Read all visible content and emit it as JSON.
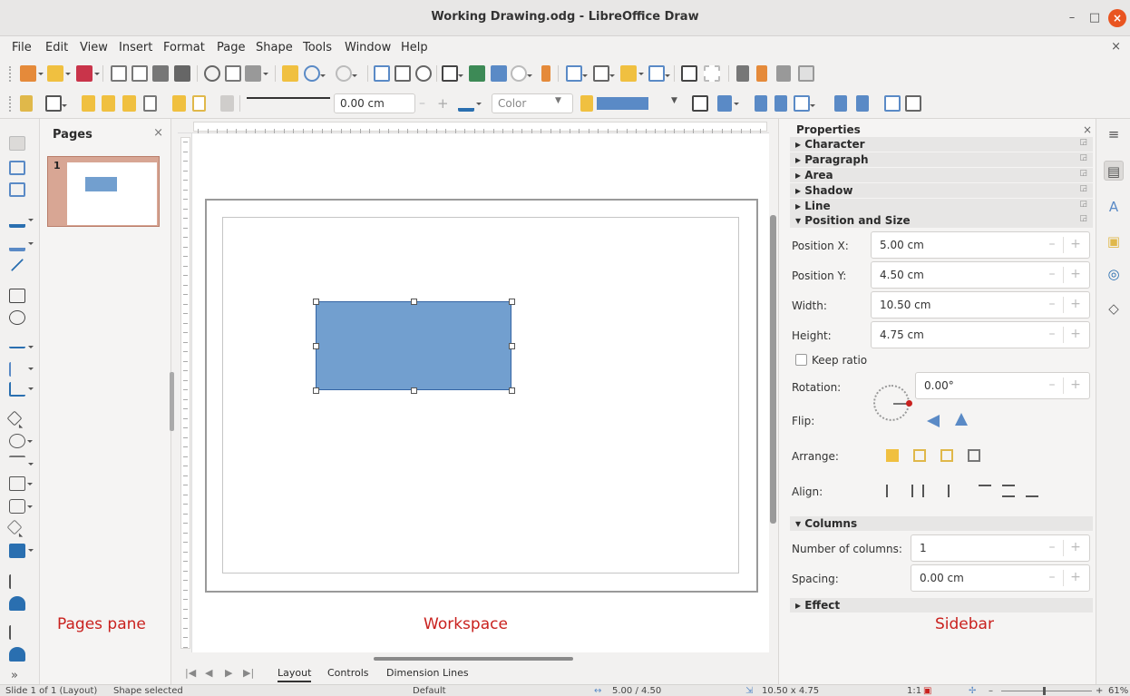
{
  "window": {
    "title": "Working Drawing.odg - LibreOffice Draw",
    "minimize": "–",
    "maximize": "□",
    "close": "×"
  },
  "menubar": {
    "items": [
      "File",
      "Edit",
      "View",
      "Insert",
      "Format",
      "Page",
      "Shape",
      "Tools",
      "Window",
      "Help"
    ],
    "doc_close": "×"
  },
  "line_toolbar": {
    "line_width": "0.00 cm",
    "area_style": "Color"
  },
  "pages_pane": {
    "title": "Pages",
    "close": "×",
    "slides": [
      {
        "number": "1"
      }
    ]
  },
  "canvas": {
    "shape_color": "#729fcf"
  },
  "bottom_tabs": {
    "nav_first": "|◀",
    "nav_prev": "◀",
    "nav_next": "▶",
    "nav_last": "▶|",
    "layers": [
      "Layout",
      "Controls",
      "Dimension Lines"
    ]
  },
  "sidebar": {
    "title": "Properties",
    "close": "×",
    "sections": [
      "Character",
      "Paragraph",
      "Area",
      "Shadow",
      "Line",
      "Position and Size"
    ],
    "position_size": {
      "position_x_label": "Position X:",
      "position_x": "5.00 cm",
      "position_y_label": "Position Y:",
      "position_y": "4.50 cm",
      "width_label": "Width:",
      "width": "10.50 cm",
      "height_label": "Height:",
      "height": "4.75 cm",
      "keep_ratio": "Keep ratio",
      "rotation_label": "Rotation:",
      "rotation": "0.00°",
      "flip_label": "Flip:",
      "arrange_label": "Arrange:",
      "align_label": "Align:"
    },
    "columns": {
      "title": "Columns",
      "number_label": "Number of columns:",
      "number": "1",
      "spacing_label": "Spacing:",
      "spacing": "0.00 cm"
    },
    "effect": {
      "title": "Effect"
    }
  },
  "annotations": {
    "pages_pane": "Pages pane",
    "workspace": "Workspace",
    "sidebar": "Sidebar",
    "color": "#c9211e"
  },
  "statusbar": {
    "slide": "Slide 1 of 1 (Layout)",
    "selection": "Shape selected",
    "master": "Default",
    "position": "5.00 / 4.50",
    "size": "10.50 x 4.75",
    "scale": "1:1",
    "zoom": "61%"
  }
}
